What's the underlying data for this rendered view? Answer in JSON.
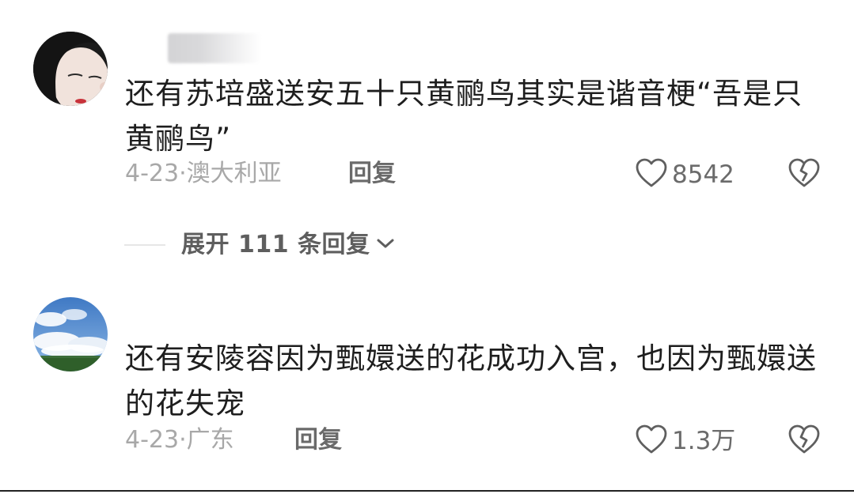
{
  "comments": [
    {
      "content": "还有苏培盛送安五十只黄鹂鸟其实是谐音梗“吾是只黄鹂鸟”",
      "date": "4-23",
      "location": "澳大利亚",
      "reply_label": "回复",
      "like_count": "8542"
    },
    {
      "content": "还有安陵容因为甄嬛送的花成功入宫，也因为甄嬛送的花失宠",
      "date": "4-23",
      "location": "广东",
      "reply_label": "回复",
      "like_count": "1.3万"
    }
  ],
  "expand_replies": {
    "label": "展开 111 条回复"
  },
  "icons": {
    "like": "heart-outline-icon",
    "dislike": "broken-heart-icon",
    "expand": "chevron-down-icon"
  },
  "colors": {
    "text": "#1e1e1e",
    "meta": "#a8a8a8",
    "action": "#6a6a6a"
  },
  "meta_separator": "·"
}
